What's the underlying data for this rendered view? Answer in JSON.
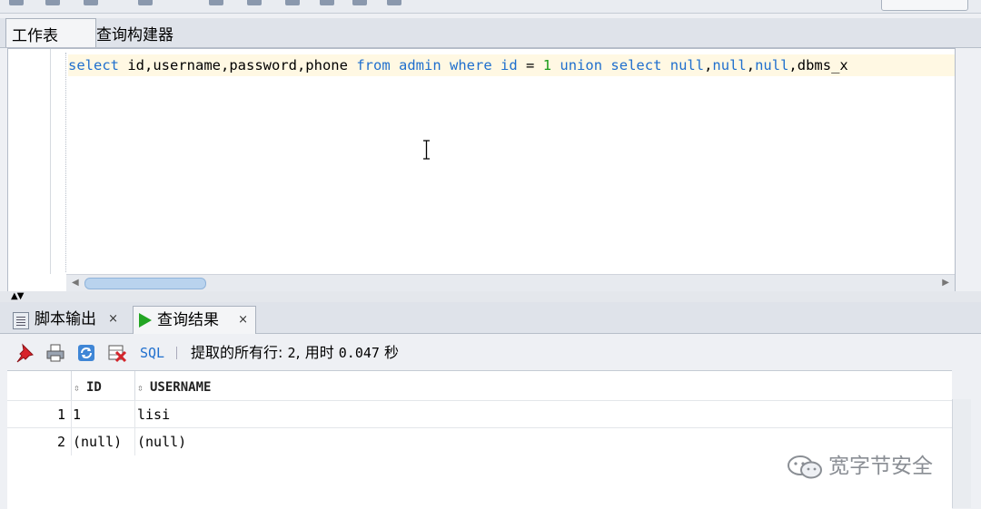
{
  "worksheet_tabs": {
    "worksheet": "工作表",
    "query_builder": "查询构建器"
  },
  "editor": {
    "sql_tokens": [
      {
        "t": "select",
        "k": "kw"
      },
      {
        "t": " ",
        "k": "id"
      },
      {
        "t": "id,username,password,phone",
        "k": "id"
      },
      {
        "t": " ",
        "k": "id"
      },
      {
        "t": "from",
        "k": "kw"
      },
      {
        "t": " ",
        "k": "id"
      },
      {
        "t": "admin",
        "k": "kw"
      },
      {
        "t": " ",
        "k": "id"
      },
      {
        "t": "where",
        "k": "kw"
      },
      {
        "t": " ",
        "k": "id"
      },
      {
        "t": "id",
        "k": "kw"
      },
      {
        "t": " = ",
        "k": "id"
      },
      {
        "t": "1",
        "k": "num"
      },
      {
        "t": " ",
        "k": "id"
      },
      {
        "t": "union",
        "k": "kw"
      },
      {
        "t": " ",
        "k": "id"
      },
      {
        "t": "select",
        "k": "kw"
      },
      {
        "t": " ",
        "k": "id"
      },
      {
        "t": "null",
        "k": "kw"
      },
      {
        "t": ",",
        "k": "id"
      },
      {
        "t": "null",
        "k": "kw"
      },
      {
        "t": ",",
        "k": "id"
      },
      {
        "t": "null",
        "k": "kw"
      },
      {
        "t": ",",
        "k": "id"
      },
      {
        "t": "dbms_x",
        "k": "id"
      }
    ]
  },
  "result_tabs": {
    "script_output": "脚本输出",
    "query_result": "查询结果",
    "close_glyph": "×"
  },
  "result_toolbar": {
    "sql_label": "SQL",
    "fetch_prefix": "提取的所有行: ",
    "rows_fetched": "2",
    "time_label": ", 用时 ",
    "elapsed": "0.047",
    "seconds_unit": " 秒"
  },
  "grid": {
    "columns": [
      "ID",
      "USERNAME"
    ],
    "rows": [
      {
        "n": "1",
        "id": "1",
        "username": "lisi"
      },
      {
        "n": "2",
        "id": "(null)",
        "username": "(null)"
      }
    ]
  },
  "watermark": "宽字节安全",
  "colors": {
    "keyword": "#1f6fce",
    "number": "#1a9b1a",
    "highlight_line": "#fff8e3",
    "run_green": "#23a523"
  }
}
